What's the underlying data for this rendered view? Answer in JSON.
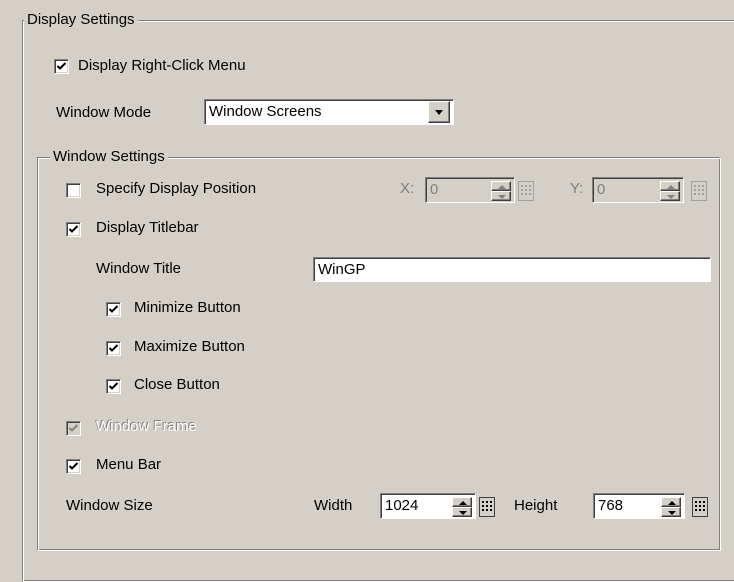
{
  "display_settings": {
    "legend": "Display Settings",
    "right_click_menu": {
      "label": "Display Right-Click Menu",
      "checked": true
    },
    "window_mode": {
      "label": "Window Mode",
      "selected": "Window Screens"
    }
  },
  "window_settings": {
    "legend": "Window Settings",
    "specify_position": {
      "label": "Specify Display Position",
      "checked": false
    },
    "x_label": "X:",
    "x_value": "0",
    "y_label": "Y:",
    "y_value": "0",
    "display_titlebar": {
      "label": "Display Titlebar",
      "checked": true
    },
    "window_title_label": "Window Title",
    "window_title_value": "WinGP",
    "minimize": {
      "label": "Minimize Button",
      "checked": true
    },
    "maximize": {
      "label": "Maximize Button",
      "checked": true
    },
    "close": {
      "label": "Close Button",
      "checked": true
    },
    "window_frame": {
      "label": "Window Frame",
      "checked": true,
      "enabled": false
    },
    "menu_bar": {
      "label": "Menu Bar",
      "checked": true
    },
    "window_size_label": "Window Size",
    "width_label": "Width",
    "width_value": "1024",
    "height_label": "Height",
    "height_value": "768"
  },
  "icons": {
    "checkmark": "checkmark-icon",
    "dropdown": "chevron-down-icon",
    "spin_up": "spin-up-icon",
    "spin_down": "spin-down-icon",
    "keypad": "keypad-icon"
  },
  "colors": {
    "face": "#d4d0c8",
    "shadow": "#808080",
    "highlight": "#ffffff"
  }
}
